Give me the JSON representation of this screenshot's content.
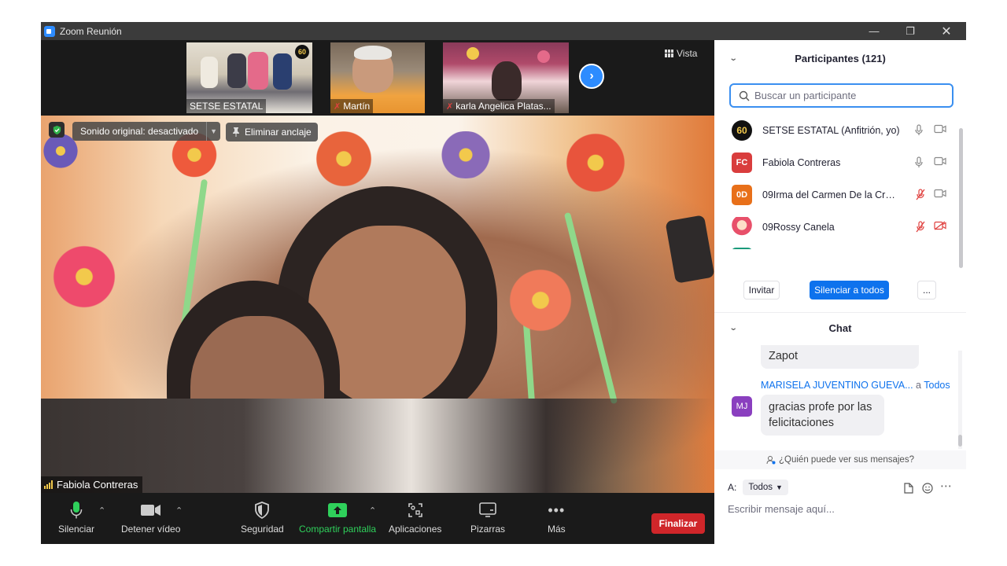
{
  "window": {
    "title": "Zoom Reunión"
  },
  "strip": {
    "thumbnails": [
      {
        "name": "SETSE ESTATAL",
        "muted": false
      },
      {
        "name": "Martín",
        "muted": true
      },
      {
        "name": "karla Angelica  Platas...",
        "muted": true
      }
    ],
    "view_label": "Vista"
  },
  "main_video": {
    "sound_label": "Sonido original: desactivado",
    "unpin_label": "Eliminar anclaje",
    "speaker_name": "Fabiola Contreras"
  },
  "toolbar": {
    "mute_label": "Silenciar",
    "video_label": "Detener vídeo",
    "security_label": "Seguridad",
    "share_label": "Compartir pantalla",
    "apps_label": "Aplicaciones",
    "whiteboards_label": "Pizarras",
    "more_label": "Más",
    "end_label": "Finalizar"
  },
  "participants": {
    "title": "Participantes (121)",
    "search_placeholder": "Buscar un participante",
    "list": [
      {
        "initials": "60",
        "name": "SETSE ESTATAL (Anfitrión, yo)",
        "color": "#111111"
      },
      {
        "initials": "FC",
        "name": "Fabiola Contreras",
        "color": "#d93d3d"
      },
      {
        "initials": "0D",
        "name": "09Irma del Carmen De la Cruz ...",
        "color": "#e8701a"
      },
      {
        "initials": "",
        "name": "09Rossy Canela",
        "color": "#f3a3b5"
      }
    ],
    "invite_label": "Invitar",
    "mute_all_label": "Silenciar a todos",
    "more_label": "..."
  },
  "chat": {
    "title": "Chat",
    "prev_message": "Zapot",
    "sender": "MARISELA JUVENTINO GUEVA...",
    "sender_to": "a",
    "sender_to_target": "Todos",
    "sender_initials": "MJ",
    "sender_color": "#8a3fbf",
    "message_line1": "gracias profe por las",
    "message_line2": "felicitaciones",
    "who_sees": "¿Quién puede ver sus mensajes?",
    "to_label": "A:",
    "to_value": "Todos",
    "input_placeholder": "Escribir mensaje aquí..."
  }
}
